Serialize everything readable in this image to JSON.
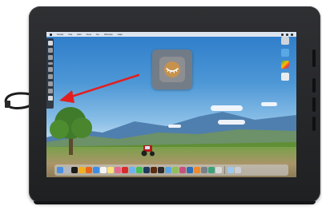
{
  "device": {
    "brand_label": "",
    "accent_colors": {
      "arrow": "#e21f1f",
      "sky_top": "#2d7cc9",
      "grass": "#5f8f34",
      "bezel": "#2b2c2f"
    }
  },
  "menubar": {
    "items": [
      "Finder",
      "File",
      "Edit",
      "View",
      "Go",
      "Window",
      "Help"
    ]
  },
  "left_toolbar": {
    "buttons": [
      "pen-icon",
      "eraser-icon",
      "brush-icon",
      "settings-icon",
      "touch-icon",
      "keyboard-icon",
      "pan-icon",
      "radial-menu-icon"
    ]
  },
  "center_popup": {
    "icon": "eye-closed-icon"
  },
  "desktop_icons": [
    {
      "icon": "drive-icon",
      "label": ""
    },
    {
      "icon": "folder-icon",
      "label": ""
    },
    {
      "icon": "play-store-icon",
      "label": ""
    },
    {
      "icon": "file-icon",
      "label": ""
    }
  ],
  "dock": {
    "icons": [
      "finder-icon",
      "launchpad-icon",
      "terminal-icon",
      "chrome-icon",
      "firefox-icon",
      "safari-icon",
      "calendar-icon",
      "notes-icon",
      "photos-icon",
      "acrobat-icon",
      "mail-icon",
      "messages-icon",
      "photoshop-icon",
      "illustrator-icon",
      "tablet-icon",
      "folder-icon",
      "preview-icon",
      "app-icon",
      "app-icon",
      "app-icon",
      "app-icon",
      "app-icon",
      "app-icon",
      "downloads-icon",
      "trash-icon"
    ]
  }
}
